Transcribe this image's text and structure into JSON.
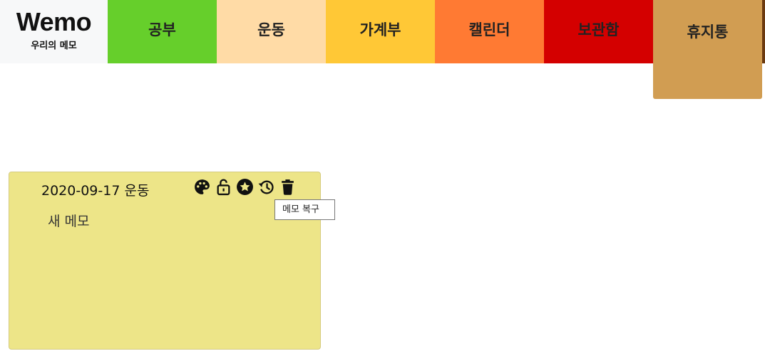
{
  "logo": {
    "title": "Wemo",
    "subtitle": "우리의 메모"
  },
  "tabs": [
    {
      "label": "공부",
      "color": "#66cf2b"
    },
    {
      "label": "운동",
      "color": "#ffdba6"
    },
    {
      "label": "가계부",
      "color": "#ffc836"
    },
    {
      "label": "캘린더",
      "color": "#ff7a33"
    },
    {
      "label": "보관함",
      "color": "#d40000"
    },
    {
      "label": "휴지통",
      "color": "#d19d52",
      "active": true
    }
  ],
  "memo": {
    "date": "2020-09-17",
    "category": "운동",
    "content": "새 메모",
    "background": "#ede588",
    "actions": [
      "palette-icon",
      "unlock-icon",
      "star-icon",
      "restore-icon",
      "trash-icon"
    ]
  },
  "tooltip": {
    "text": "메모 복구"
  }
}
